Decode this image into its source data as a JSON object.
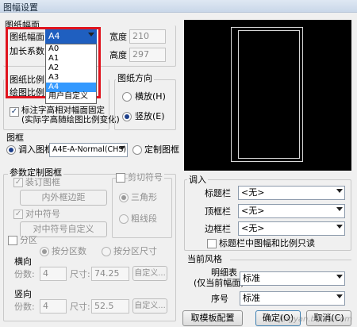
{
  "window": {
    "title": "图幅设置"
  },
  "paper_size_group": {
    "title": "图纸幅面",
    "size_label": "图纸幅面",
    "size_value": "A4",
    "size_options": [
      "A0",
      "A1",
      "A2",
      "A3",
      "A4",
      "用户自定义"
    ],
    "selected_option": "A4",
    "extend_label": "加长系数",
    "width_label": "宽度",
    "width_value": "210",
    "height_label": "高度",
    "height_value": "297"
  },
  "scale_group": {
    "title": "图纸比例",
    "drawing_scale_label": "绘图比例",
    "annotate_checkbox_line1": "标注字高相对幅面固定",
    "annotate_checkbox_line2": "(实际字高随绘图比例变化)"
  },
  "orientation_group": {
    "title": "图纸方向",
    "landscape_label": "横放(H)",
    "portrait_label": "竖放(E)",
    "selected": "portrait"
  },
  "frame_group": {
    "title": "图框",
    "load_frame_label": "调入图框",
    "frame_value": "A4E-A-Normal(CHS)",
    "custom_frame_label": "定制图框"
  },
  "param_group": {
    "title": "参数定制图框",
    "binding_frame_label": "装订图框",
    "inner_border_button": "内外框边距",
    "center_marks_label": "对中符号",
    "center_custom_button": "对中符号自定义",
    "trim_marks_label": "剪切符号",
    "triangle_label": "三角形",
    "thick_line_label": "粗线段",
    "zoning_label": "分区",
    "by_count_label": "按分区数",
    "by_size_label": "按分区尺寸",
    "horizontal": {
      "title": "横向",
      "count_label": "份数:",
      "count_value": "4",
      "size_label": "尺寸:",
      "size_value": "74.25",
      "custom_button": "自定义..."
    },
    "vertical": {
      "title": "竖向",
      "count_label": "份数:",
      "count_value": "4",
      "size_label": "尺寸:",
      "size_value": "52.5",
      "custom_button": "自定义..."
    }
  },
  "import_group": {
    "title": "调入",
    "title_block_label": "标题栏",
    "title_block_value": "<无>",
    "top_block_label": "顶框栏",
    "top_block_value": "<无>",
    "side_block_label": "边框栏",
    "side_block_value": "<无>",
    "readonly_checkbox": "标题栏中图幅和比例只读"
  },
  "style_group": {
    "title": "当前风格",
    "detail_label_line1": "明细表",
    "detail_label_line2": "(仅当前幅面)",
    "detail_value": "标准",
    "number_label": "序号",
    "number_value": "标准"
  },
  "buttons": {
    "template": "取模板配置",
    "ok": "确定(O)",
    "cancel": "取消(C)"
  },
  "watermark": "jingyan.baidu.com",
  "colors": {
    "highlight": "#e0141e",
    "selection": "#3399ff",
    "preview_bg": "#000000"
  }
}
